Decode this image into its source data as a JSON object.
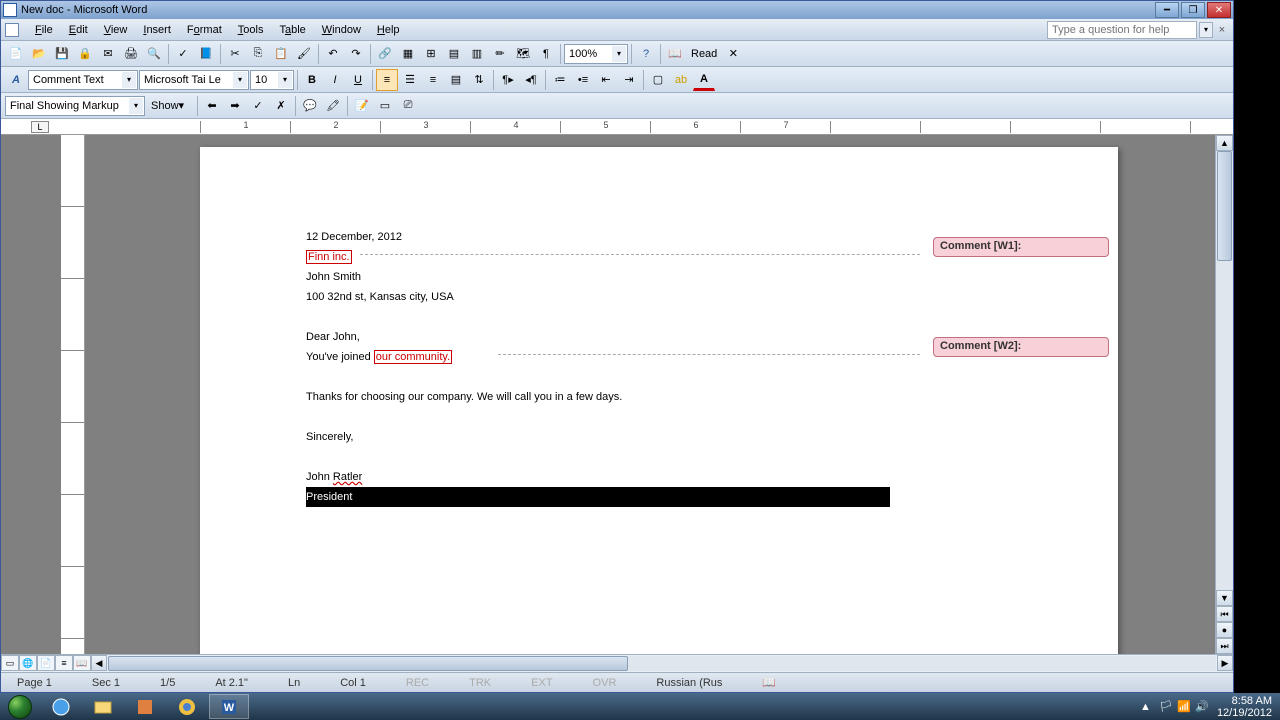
{
  "title": "New doc - Microsoft Word",
  "menus": [
    "File",
    "Edit",
    "View",
    "Insert",
    "Format",
    "Tools",
    "Table",
    "Window",
    "Help"
  ],
  "help_placeholder": "Type a question for help",
  "toolbar1": {
    "zoom": "100%",
    "read": "Read"
  },
  "toolbar2": {
    "style": "Comment Text",
    "font": "Microsoft Tai Le",
    "size": "10"
  },
  "toolbar3": {
    "markup": "Final Showing Markup",
    "show": "Show"
  },
  "ruler_label": "L",
  "ruler_numbers": [
    "1",
    "2",
    "3",
    "4",
    "5",
    "6",
    "7"
  ],
  "document": {
    "date": "12 December, 2012",
    "company_commented": "Finn inc.",
    "name": "John Smith",
    "address": "100 32nd st, Kansas city, USA",
    "greeting": "Dear John,",
    "line1_a": "You've joined ",
    "line1_commented": "our community.",
    "thanks": "Thanks for choosing our company. We will call you in a few days.",
    "closing": "Sincerely,",
    "signer": "John ",
    "signer_squig": "Ratler",
    "selected": "President"
  },
  "comments": {
    "c1": "Comment [W1]:",
    "c2": "Comment [W2]:"
  },
  "status": {
    "page": "Page  1",
    "sec": "Sec 1",
    "pages": "1/5",
    "at": "At  2.1\"",
    "ln": "Ln",
    "col": "Col  1",
    "rec": "REC",
    "trk": "TRK",
    "ext": "EXT",
    "ovr": "OVR",
    "lang": "Russian (Rus"
  },
  "systray": {
    "time": "8:58 AM",
    "date": "12/19/2012"
  }
}
